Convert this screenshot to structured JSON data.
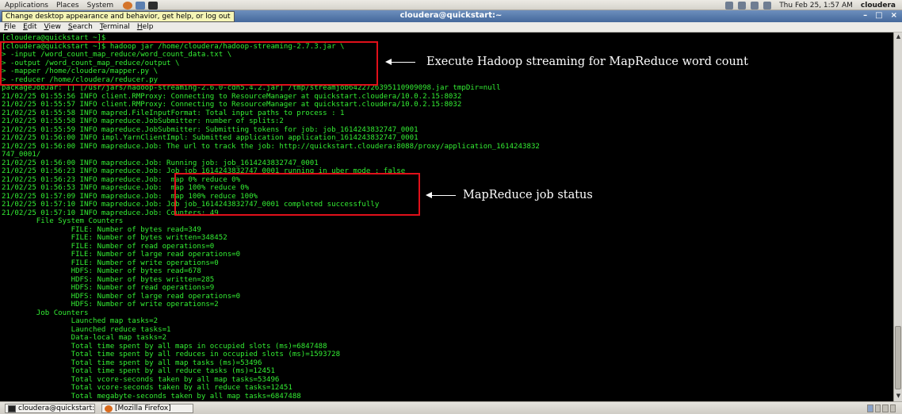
{
  "top_panel": {
    "menus": [
      "Applications",
      "Places",
      "System"
    ],
    "datetime": "Thu Feb 25,  1:57 AM",
    "user": "cloudera"
  },
  "tooltip": "Change desktop appearance and behavior, get help, or log out",
  "window": {
    "title": "cloudera@quickstart:~",
    "buttons": {
      "minimize": "–",
      "maximize": "□",
      "close": "×"
    }
  },
  "menubar": [
    "File",
    "Edit",
    "View",
    "Search",
    "Terminal",
    "Help"
  ],
  "terminal": {
    "lines": [
      "[cloudera@quickstart ~]$",
      "[cloudera@quickstart ~]$ hadoop jar /home/cloudera/hadoop-streaming-2.7.3.jar \\",
      "> -input /word_count_map_reduce/word_count_data.txt \\",
      "> -output /word_count_map_reduce/output \\",
      "> -mapper /home/cloudera/mapper.py \\",
      "> -reducer /home/cloudera/reducer.py",
      "packageJobJar: [] [/usr/jars/hadoop-streaming-2.6.0-cdh5.4.2.jar] /tmp/streamjob6422726395110909098.jar tmpDir=null",
      "21/02/25 01:55:56 INFO client.RMProxy: Connecting to ResourceManager at quickstart.cloudera/10.0.2.15:8032",
      "21/02/25 01:55:57 INFO client.RMProxy: Connecting to ResourceManager at quickstart.cloudera/10.0.2.15:8032",
      "21/02/25 01:55:58 INFO mapred.FileInputFormat: Total input paths to process : 1",
      "21/02/25 01:55:58 INFO mapreduce.JobSubmitter: number of splits:2",
      "21/02/25 01:55:59 INFO mapreduce.JobSubmitter: Submitting tokens for job: job_1614243832747_0001",
      "21/02/25 01:56:00 INFO impl.YarnClientImpl: Submitted application application_1614243832747_0001",
      "21/02/25 01:56:00 INFO mapreduce.Job: The url to track the job: http://quickstart.cloudera:8088/proxy/application_1614243832",
      "747_0001/",
      "21/02/25 01:56:00 INFO mapreduce.Job: Running job: job_1614243832747_0001",
      "21/02/25 01:56:23 INFO mapreduce.Job: Job job_1614243832747_0001 running in uber mode : false",
      "21/02/25 01:56:23 INFO mapreduce.Job:  map 0% reduce 0%",
      "21/02/25 01:56:53 INFO mapreduce.Job:  map 100% reduce 0%",
      "21/02/25 01:57:09 INFO mapreduce.Job:  map 100% reduce 100%",
      "21/02/25 01:57:10 INFO mapreduce.Job: Job job_1614243832747_0001 completed successfully",
      "21/02/25 01:57:10 INFO mapreduce.Job: Counters: 49",
      "        File System Counters",
      "                FILE: Number of bytes read=349",
      "                FILE: Number of bytes written=348452",
      "                FILE: Number of read operations=0",
      "                FILE: Number of large read operations=0",
      "                FILE: Number of write operations=0",
      "                HDFS: Number of bytes read=678",
      "                HDFS: Number of bytes written=285",
      "                HDFS: Number of read operations=9",
      "                HDFS: Number of large read operations=0",
      "                HDFS: Number of write operations=2",
      "        Job Counters",
      "                Launched map tasks=2",
      "                Launched reduce tasks=1",
      "                Data-local map tasks=2",
      "                Total time spent by all maps in occupied slots (ms)=6847488",
      "                Total time spent by all reduces in occupied slots (ms)=1593728",
      "                Total time spent by all map tasks (ms)=53496",
      "                Total time spent by all reduce tasks (ms)=12451",
      "                Total vcore-seconds taken by all map tasks=53496",
      "                Total vcore-seconds taken by all reduce tasks=12451",
      "                Total megabyte-seconds taken by all map tasks=6847488"
    ]
  },
  "annotations": {
    "command": "Execute Hadoop streaming for MapReduce word count",
    "status": "MapReduce job status"
  },
  "taskbar": {
    "tasks": [
      "cloudera@quickstart:~",
      "[Mozilla Firefox]"
    ]
  },
  "colors": {
    "terminal_fg": "#33ee33",
    "terminal_bg": "#000000",
    "annotation_box": "#e0101a"
  }
}
